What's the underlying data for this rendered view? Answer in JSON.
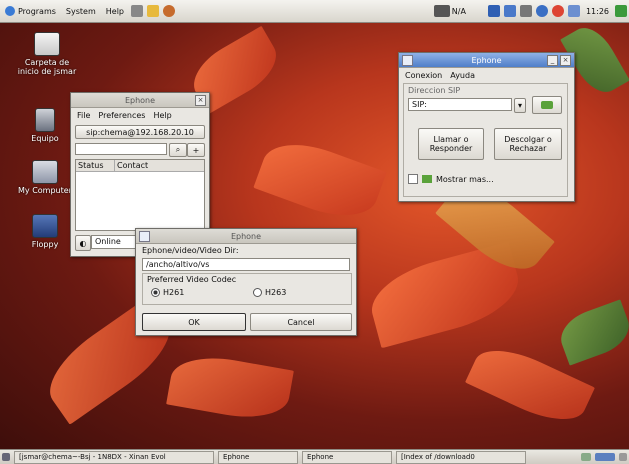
{
  "top_panel": {
    "menus": [
      "Programs",
      "System",
      "Help"
    ],
    "network_label": "N/A",
    "clock": "11:26"
  },
  "desktop_icons": [
    {
      "label": "Carpeta de inicio de jsmar"
    },
    {
      "label": "Equipo"
    },
    {
      "label": "My Computer"
    },
    {
      "label": "Floppy"
    }
  ],
  "ephone_main": {
    "title": "Ephone",
    "menu": [
      "File",
      "Preferences",
      "Help"
    ],
    "sip_button": "sip:chema@192.168.20.10",
    "columns": [
      "Status",
      "Contact"
    ],
    "status_value": "Online"
  },
  "ephone_dialog": {
    "title": "Ephone",
    "menu": [
      "Conexion",
      "Ayuda"
    ],
    "group_label": "Direccion SIP",
    "sip_value": "SIP:",
    "call_button": "Llamar o Responder",
    "reject_button": "Descolgar o Rechazar",
    "show_more": "Mostrar mas..."
  },
  "video_prefs": {
    "title": "Ephone",
    "device_label": "Ephone/video/Video Dir:",
    "device_value": "/ancho/altivo/vs",
    "codec_group": "Preferred Video Codec",
    "codec_options": [
      "H261",
      "H263"
    ],
    "selected_codec": "H261",
    "ok_label": "OK",
    "cancel_label": "Cancel"
  },
  "taskbar": {
    "items": [
      "[jsmar@chema~-Bsj - 1N8DX - Xinan Evol",
      "Ephone",
      "Ephone",
      "[Index of /download0"
    ]
  }
}
